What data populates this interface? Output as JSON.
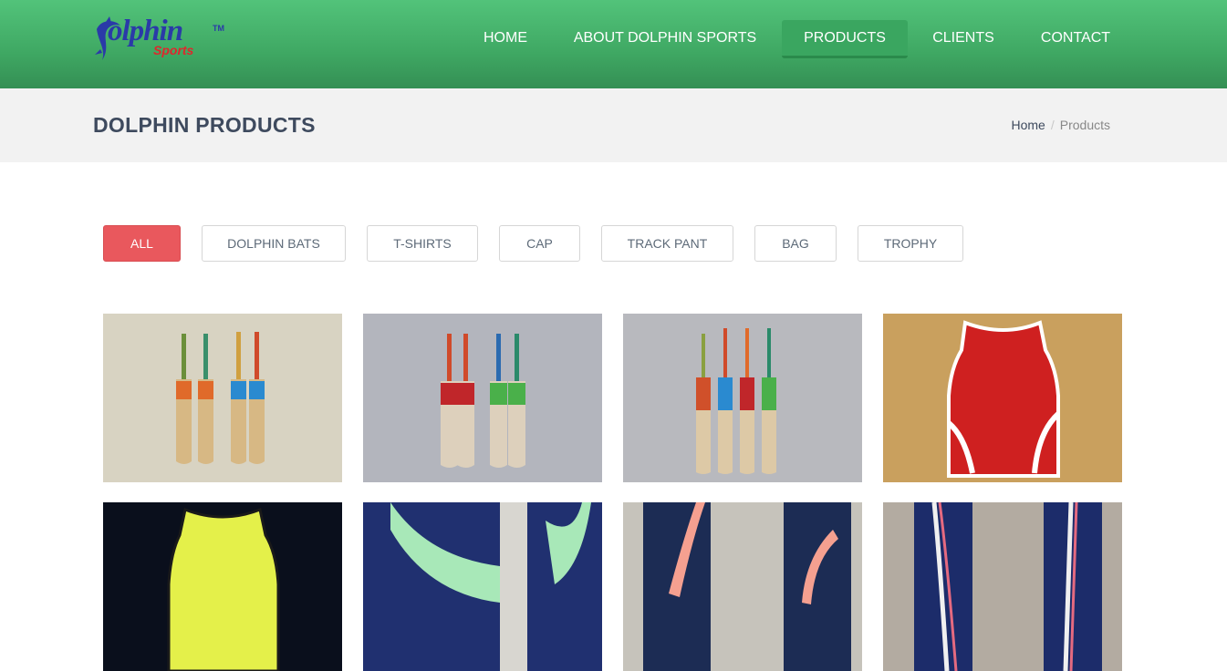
{
  "logo": {
    "main": "olphin",
    "sub": "Sports",
    "tm": "TM",
    "initial": "D"
  },
  "nav": {
    "items": [
      {
        "label": "HOME"
      },
      {
        "label": "ABOUT DOLPHIN SPORTS"
      },
      {
        "label": "PRODUCTS",
        "active": true
      },
      {
        "label": "CLIENTS"
      },
      {
        "label": "CONTACT"
      }
    ]
  },
  "page": {
    "title": "DOLPHIN PRODUCTS"
  },
  "breadcrumb": {
    "home": "Home",
    "separator": "/",
    "current": "Products"
  },
  "filters": [
    {
      "label": "ALL",
      "active": true
    },
    {
      "label": "DOLPHIN BATS"
    },
    {
      "label": "T-SHIRTS"
    },
    {
      "label": "CAP"
    },
    {
      "label": "TRACK PANT"
    },
    {
      "label": "BAG"
    },
    {
      "label": "TROPHY"
    }
  ],
  "products": [
    {
      "name": "cricket-bats-photo-1"
    },
    {
      "name": "cricket-bats-photo-2"
    },
    {
      "name": "cricket-bats-photo-3"
    },
    {
      "name": "red-jersey-photo"
    },
    {
      "name": "yellow-jersey-photo"
    },
    {
      "name": "track-pant-photo-1"
    },
    {
      "name": "track-pant-photo-2"
    },
    {
      "name": "track-pant-photo-3"
    }
  ],
  "colors": {
    "header_green": "#4cbb74",
    "active_filter": "#e9585d",
    "title_text": "#3e4a5e"
  }
}
